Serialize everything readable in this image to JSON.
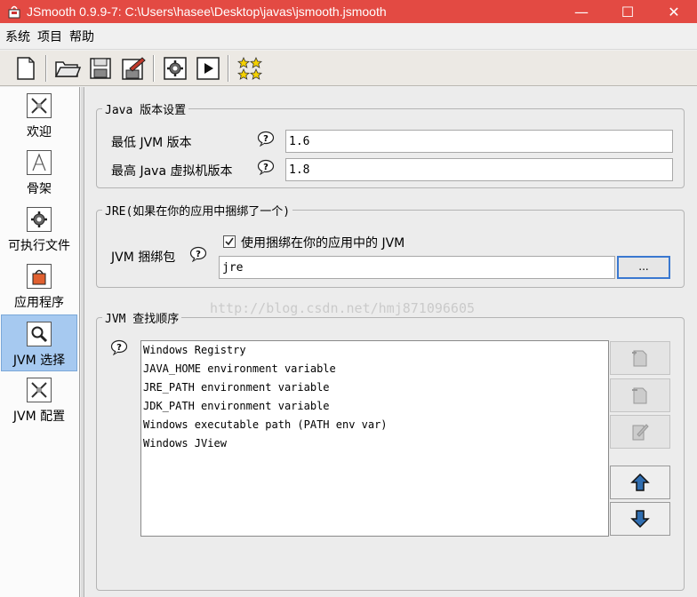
{
  "window": {
    "title": "JSmooth 0.9.9-7: C:\\Users\\hasee\\Desktop\\javas\\jsmooth.jsmooth",
    "minimize": "—",
    "maximize": "☐",
    "close": "✕"
  },
  "menu": [
    "系统",
    "项目",
    "帮助"
  ],
  "toolbar": {
    "icons": [
      "new-file-icon",
      "open-folder-icon",
      "save-icon",
      "save-as-icon",
      "compile-gear-icon",
      "run-icon",
      "stars-icon"
    ]
  },
  "sidebar": {
    "items": [
      {
        "label": "欢迎",
        "icon": "welcome-icon"
      },
      {
        "label": "骨架",
        "icon": "skeleton-icon"
      },
      {
        "label": "可执行文件",
        "icon": "executable-icon"
      },
      {
        "label": "应用程序",
        "icon": "application-icon"
      },
      {
        "label": "JVM 选择",
        "icon": "jvm-select-icon",
        "selected": true
      },
      {
        "label": "JVM 配置",
        "icon": "jvm-config-icon"
      }
    ]
  },
  "java_version": {
    "legend": "Java 版本设置",
    "min_label": "最低 JVM 版本",
    "min_value": "1.6",
    "max_label": "最高 Java 虚拟机版本",
    "max_value": "1.8"
  },
  "jre": {
    "legend": "JRE(如果在你的应用中捆绑了一个)",
    "bundle_label": "JVM 捆绑包",
    "checkbox_label": "使用捆绑在你的应用中的 JVM",
    "checkbox_checked": true,
    "path_value": "jre",
    "browse_label": "..."
  },
  "jvm_search": {
    "legend": "JVM 查找顺序",
    "items": [
      "Windows Registry",
      "JAVA_HOME environment variable",
      "JRE_PATH environment variable",
      "JDK_PATH environment variable",
      "Windows executable path (PATH env var)",
      "Windows JView"
    ],
    "buttons": [
      "add-icon",
      "remove-icon",
      "edit-icon",
      "arrow-up-icon",
      "arrow-down-icon"
    ]
  },
  "watermark": "http://blog.csdn.net/hmj871096605",
  "colors": {
    "titlebar": "#e34a43",
    "selected": "#a6c9f0",
    "browse_border": "#3a78d0"
  }
}
